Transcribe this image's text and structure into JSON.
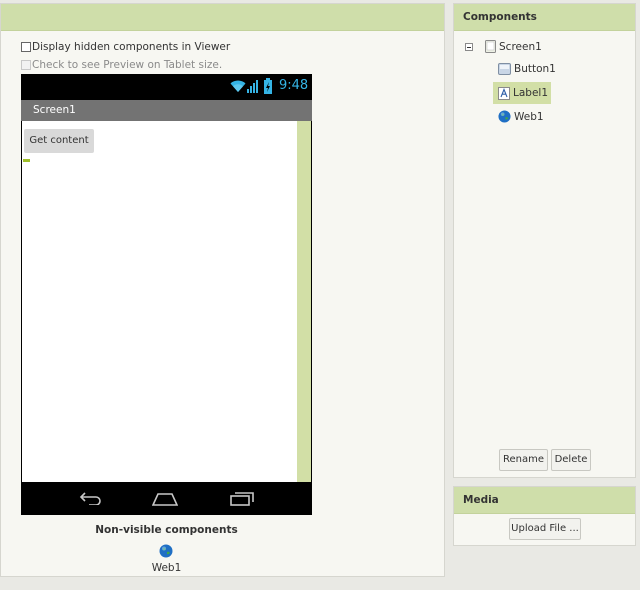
{
  "viewer": {
    "show_hidden_label": "Display hidden components in Viewer",
    "tablet_preview_label": "Check to see Preview on Tablet size."
  },
  "phone": {
    "clock": "9:48",
    "screen_title": "Screen1",
    "button_label": "Get content",
    "status_icons": [
      "wifi-icon",
      "signal-icon",
      "battery-icon"
    ],
    "nav_icons": [
      "back-icon",
      "home-icon",
      "recents-icon"
    ]
  },
  "nonvisible": {
    "title": "Non-visible components",
    "items": [
      {
        "label": "Web1",
        "icon": "web-globe-icon"
      }
    ]
  },
  "components": {
    "title": "Components",
    "tree": [
      {
        "label": "Screen1",
        "icon": "screen-icon",
        "level": 0
      },
      {
        "label": "Button1",
        "icon": "button-icon",
        "level": 1
      },
      {
        "label": "Label1",
        "icon": "label-icon",
        "level": 1,
        "selected": true
      },
      {
        "label": "Web1",
        "icon": "web-globe-icon",
        "level": 1
      }
    ],
    "rename_label": "Rename",
    "delete_label": "Delete"
  },
  "media": {
    "title": "Media",
    "upload_label": "Upload File ..."
  },
  "colors": {
    "header_green": "#cfdeaa",
    "selection_green": "#d2dfa6",
    "clock_blue": "#35b4e5",
    "titlebar_gray": "#737373"
  }
}
